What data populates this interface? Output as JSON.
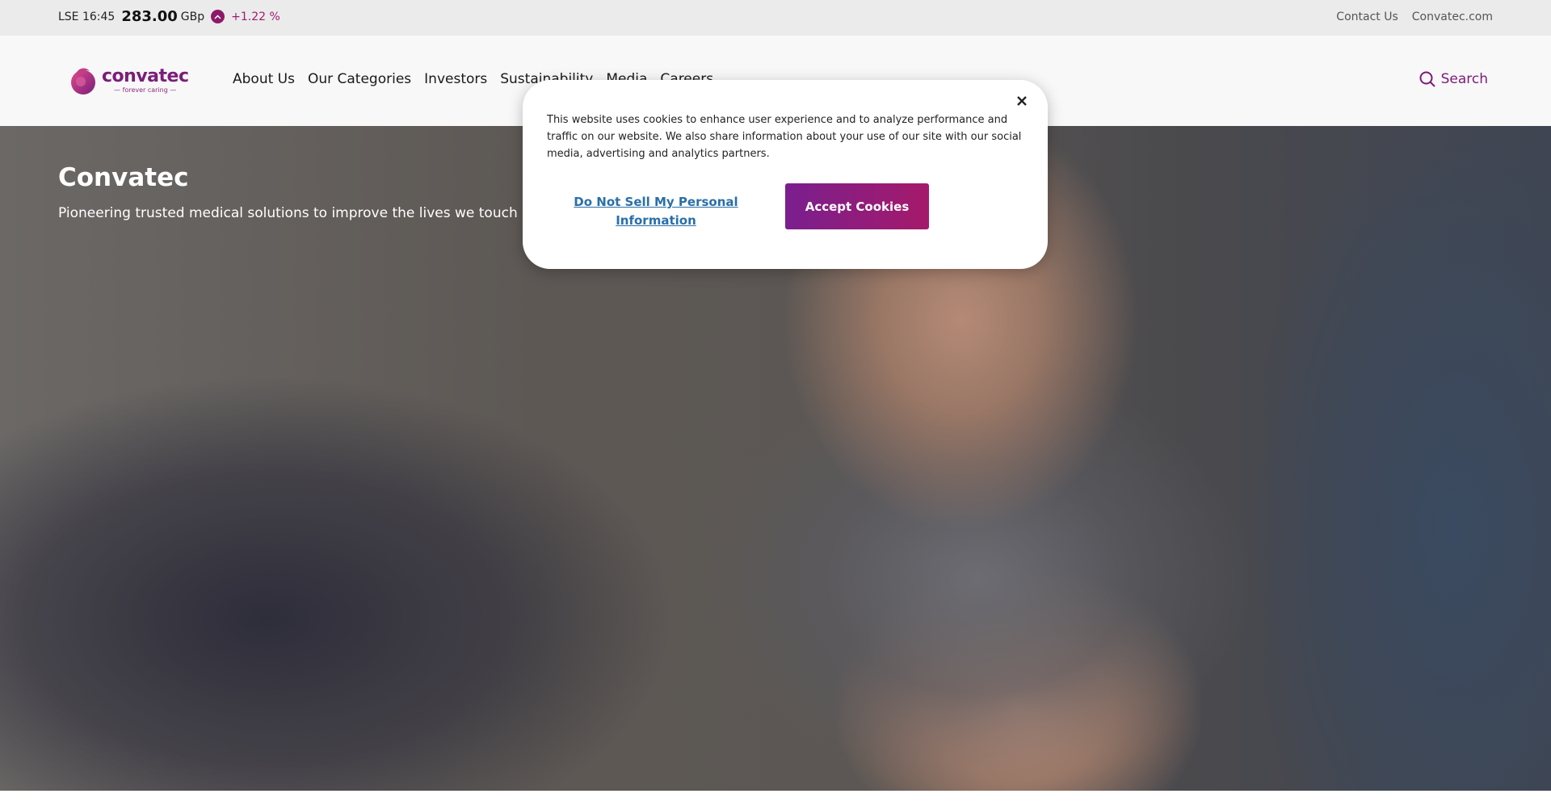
{
  "ticker": {
    "exchange_time": "LSE 16:45",
    "price": "283.00",
    "unit": "GBp",
    "change": "+1.22 %",
    "direction_icon": "chevron-up-icon",
    "accent_color": "#8c1a6a"
  },
  "top_links": [
    "Contact Us",
    "Convatec.com"
  ],
  "logo": {
    "brand": "convatec",
    "tagline": "— forever caring —"
  },
  "nav": {
    "items": [
      "About Us",
      "Our Categories",
      "Investors",
      "Sustainability",
      "Media",
      "Careers"
    ]
  },
  "search": {
    "label": "Search",
    "icon": "search-icon"
  },
  "hero": {
    "title": "Convatec",
    "subtitle": "Pioneering trusted medical solutions to improve the lives we touch"
  },
  "cookie_banner": {
    "text": "This website uses cookies to enhance user experience and to analyze performance and traffic on our website. We also share information about your use of our site with our social media, advertising and analytics partners.",
    "do_not_sell_label": "Do Not Sell My Personal Information",
    "accept_label": "Accept Cookies",
    "close_icon": "close-icon"
  },
  "colors": {
    "brand_purple": "#7a1e7a",
    "accept_gradient_start": "#7a1f8e",
    "accept_gradient_end": "#a51a6a",
    "link_blue": "#2a6fa8"
  }
}
